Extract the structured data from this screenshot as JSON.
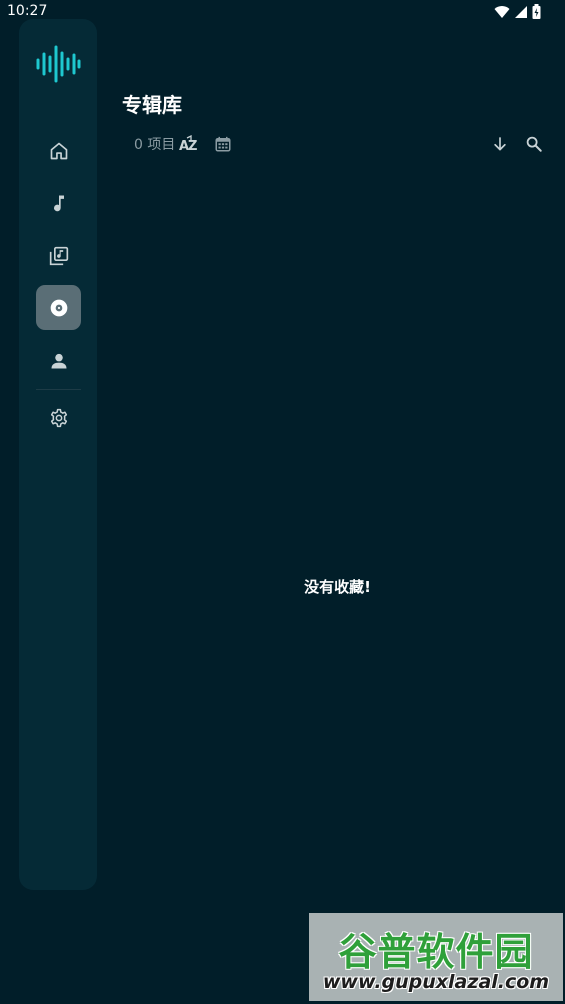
{
  "status_bar": {
    "time": "10:27",
    "icons": [
      "wifi-icon",
      "cellular-signal-icon",
      "battery-charging-icon"
    ]
  },
  "nav_rail": {
    "logo": "waveform-logo",
    "items": [
      {
        "id": "home",
        "icon": "home-icon",
        "active": false
      },
      {
        "id": "songs",
        "icon": "music-note-icon",
        "active": false
      },
      {
        "id": "playlists",
        "icon": "music-library-icon",
        "active": false
      },
      {
        "id": "albums",
        "icon": "album-disc-icon",
        "active": true
      },
      {
        "id": "artists",
        "icon": "person-icon",
        "active": false
      },
      {
        "id": "settings",
        "icon": "gear-icon",
        "active": false
      }
    ],
    "colors": {
      "background": "#052a36",
      "active": "#5a6e76",
      "icon": "#c9d3d6",
      "logo": "#1ec8d0"
    }
  },
  "header": {
    "title": "专辑库"
  },
  "toolbar": {
    "item_count": "0 项目",
    "sort_alpha_icon": "sort-az-icon",
    "sort_date_icon": "calendar-icon",
    "sort_direction_icon": "arrow-down-icon",
    "search_icon": "search-icon"
  },
  "main": {
    "empty_message": "没有收藏!"
  },
  "watermark": {
    "title": "谷普软件园",
    "url": "www.gupuxlazal.com"
  },
  "colors": {
    "background": "#011e29",
    "text_primary": "#ffffff",
    "text_secondary": "#8b9ca3"
  }
}
